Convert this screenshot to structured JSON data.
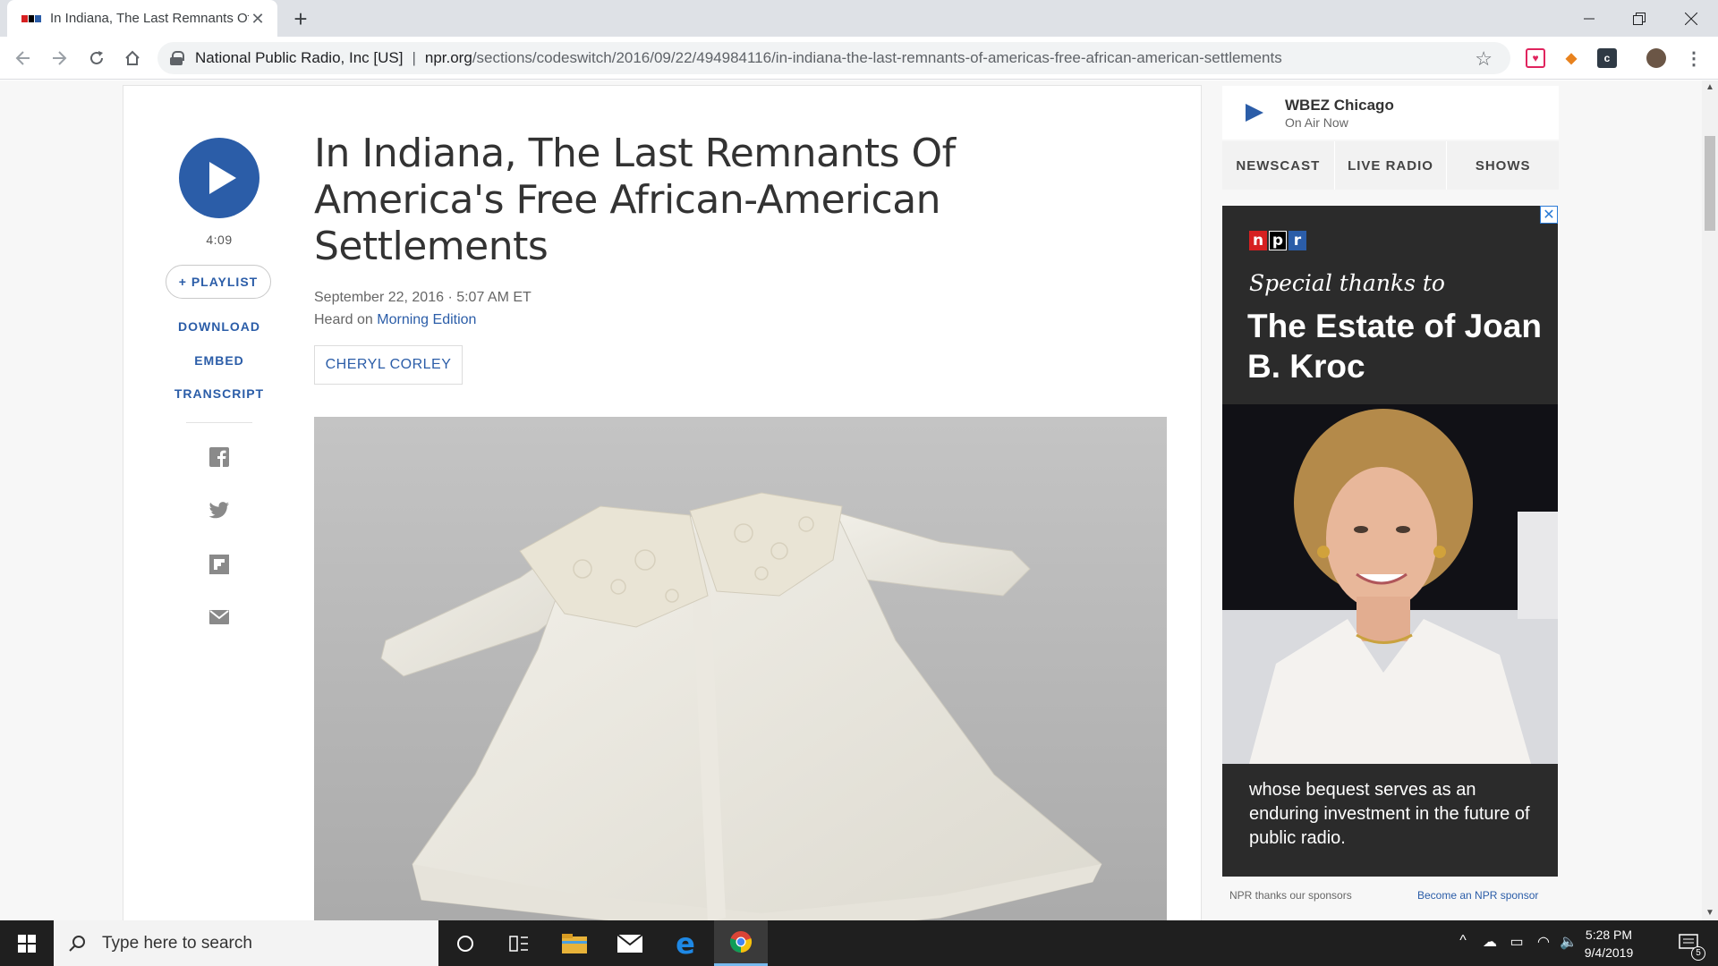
{
  "browser": {
    "tab_title": "In Indiana, The Last Remnants Of America's Free African-American Settlements",
    "tab_close": "✕",
    "new_tab": "+",
    "cert_org": "National Public Radio, Inc [US]",
    "url_domain": "npr.org",
    "url_path": "/sections/codeswitch/2016/09/22/494984116/in-indiana-the-last-remnants-of-americas-free-african-american-settlements"
  },
  "player": {
    "duration": "4:09",
    "playlist_label": "+ PLAYLIST",
    "download_label": "DOWNLOAD",
    "embed_label": "EMBED",
    "transcript_label": "TRANSCRIPT"
  },
  "article": {
    "headline": "In Indiana, The Last Remnants Of America's Free African-American Settlements",
    "dateline": "September 22, 2016 · 5:07 AM ET",
    "heard_on_prefix": "Heard on ",
    "heard_on_program": "Morning Edition",
    "byline": "CHERYL CORLEY"
  },
  "station": {
    "name": "WBEZ Chicago",
    "status": "On Air Now",
    "tabs": [
      "NEWSCAST",
      "LIVE RADIO",
      "SHOWS"
    ]
  },
  "ad": {
    "close": "✕",
    "logo_letters": [
      "n",
      "p",
      "r"
    ],
    "kicker": "Special thanks to",
    "headline": "The Estate of Joan B. Kroc",
    "body": "whose bequest serves as an enduring investment in the future of public radio.",
    "footer_left": "NPR thanks our sponsors",
    "footer_right": "Become an NPR sponsor"
  },
  "taskbar": {
    "search_placeholder": "Type here to search",
    "time": "5:28 PM",
    "date": "9/4/2019",
    "notification_count": "5"
  },
  "colors": {
    "npr_blue": "#2b5da8",
    "npr_red": "#d62021",
    "npr_black": "#000000"
  }
}
